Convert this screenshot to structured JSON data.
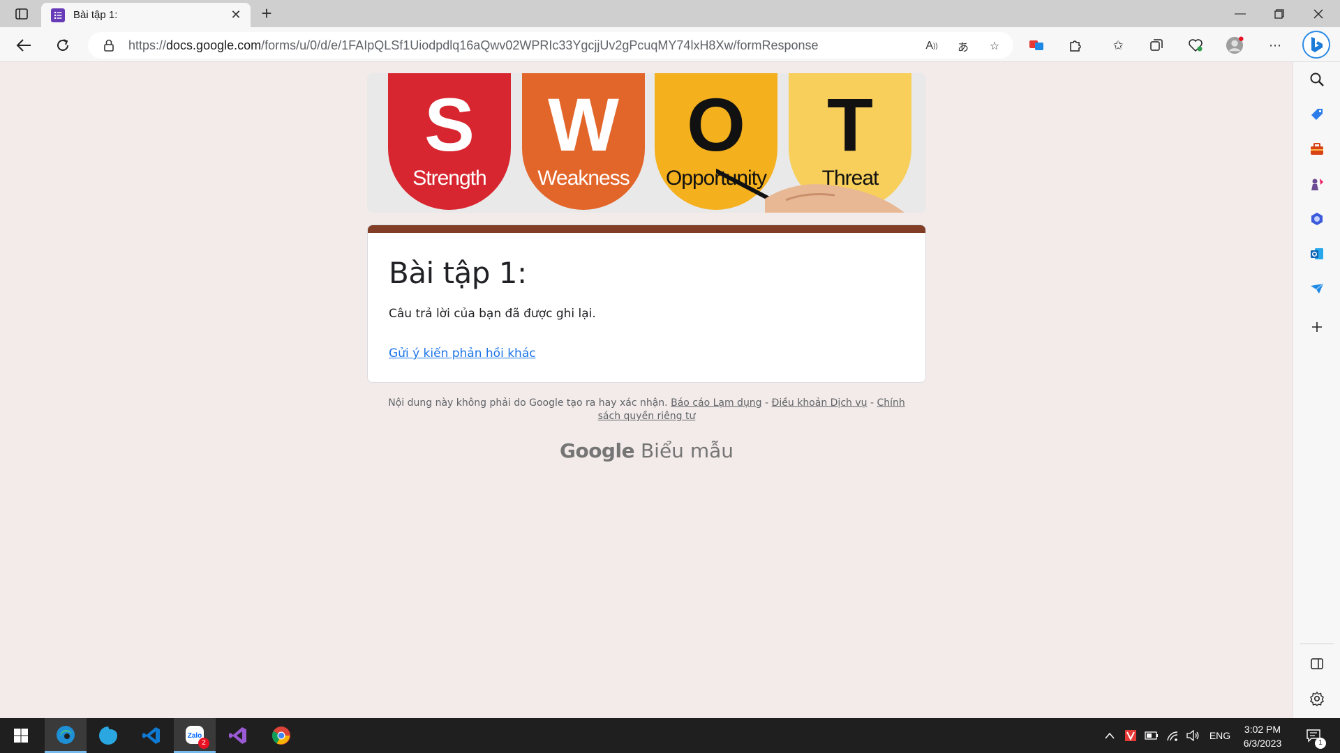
{
  "browser": {
    "tab_title": "Bài tập 1:",
    "url_scheme": "https://",
    "url_host": "docs.google.com",
    "url_path": "/forms/u/0/d/e/1FAIpQLSf1Uiodpdlq16aQwv02WPRIc33YgcjjUv2gPcuqMY74lxH8Xw/formResponse"
  },
  "banner": {
    "letters": [
      {
        "letter": "S",
        "word": "Strength",
        "color": "#d7262f",
        "text_color": "#ffffff"
      },
      {
        "letter": "W",
        "word": "Weakness",
        "color": "#e2652a",
        "text_color": "#ffffff"
      },
      {
        "letter": "O",
        "word": "Opportunity",
        "color": "#f4b01d",
        "text_color": "#111111"
      },
      {
        "letter": "T",
        "word": "Threat",
        "color": "#f7cf5a",
        "text_color": "#111111"
      }
    ]
  },
  "form": {
    "title": "Bài tập 1:",
    "confirmation": "Câu trả lời của bạn đã được ghi lại.",
    "submit_another": "Gửi ý kiến phản hồi khác",
    "accent_color": "#823d26"
  },
  "footer": {
    "disclaimer": "Nội dung này không phải do Google tạo ra hay xác nhận.",
    "report_abuse": "Báo cáo Lạm dụng",
    "separator": " - ",
    "terms": "Điều khoản Dịch vụ",
    "privacy": "Chính sách quyền riêng tư",
    "brand_google": "Google",
    "brand_product": "Biểu mẫu"
  },
  "taskbar": {
    "language": "ENG",
    "time": "3:02 PM",
    "date": "6/3/2023",
    "zalo_badge": "2",
    "notifications": "1"
  }
}
